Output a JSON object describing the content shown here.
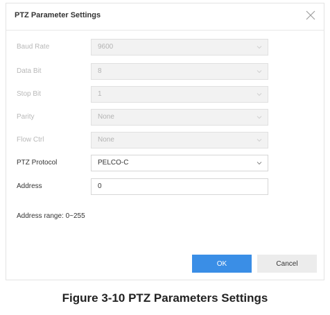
{
  "dialog": {
    "title": "PTZ Parameter Settings",
    "fields": [
      {
        "label": "Baud Rate",
        "value": "9600",
        "enabled": false,
        "type": "select"
      },
      {
        "label": "Data Bit",
        "value": "8",
        "enabled": false,
        "type": "select"
      },
      {
        "label": "Stop Bit",
        "value": "1",
        "enabled": false,
        "type": "select"
      },
      {
        "label": "Parity",
        "value": "None",
        "enabled": false,
        "type": "select"
      },
      {
        "label": "Flow Ctrl",
        "value": "None",
        "enabled": false,
        "type": "select"
      },
      {
        "label": "PTZ Protocol",
        "value": "PELCO-C",
        "enabled": true,
        "type": "select"
      },
      {
        "label": "Address",
        "value": "0",
        "enabled": true,
        "type": "input"
      }
    ],
    "address_range": "Address range: 0~255",
    "ok_label": "OK",
    "cancel_label": "Cancel",
    "accent_color": "#3a8ee6"
  },
  "caption": "Figure 3-10 PTZ Parameters Settings"
}
